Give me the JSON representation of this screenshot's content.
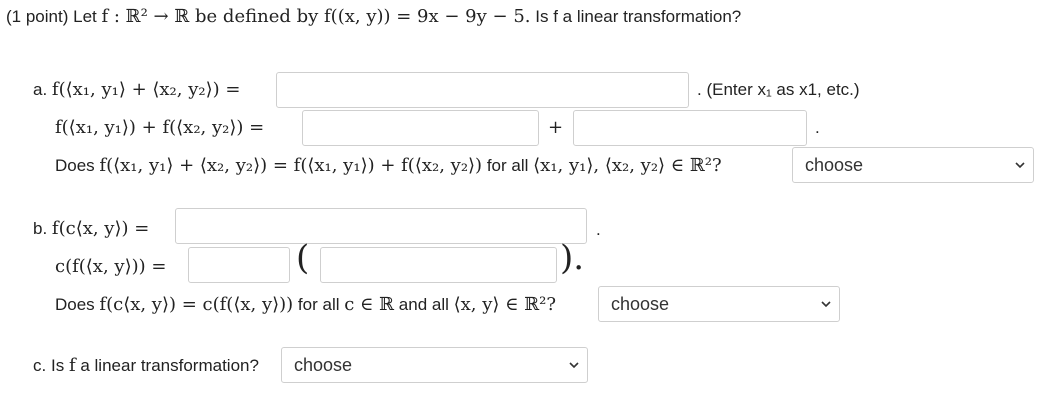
{
  "header": {
    "points": "(1 point)",
    "text_pre": "Let",
    "definition": "f : ℝ² → ℝ be defined by f((x, y)) = 9x − 9y − 5.",
    "question": "Is f a linear transformation?"
  },
  "part_a": {
    "label": "a.",
    "line1_expr": "f(⟨x₁, y₁⟩ + ⟨x₂, y₂⟩) =",
    "line1_hint": ". (Enter x₁ as x1, etc.)",
    "line2_expr": "f(⟨x₁, y₁⟩) + f(⟨x₂, y₂⟩) =",
    "plus": "+",
    "period": ".",
    "question_pre": "Does",
    "question_expr": "f(⟨x₁, y₁⟩ + ⟨x₂, y₂⟩) = f(⟨x₁, y₁⟩) + f(⟨x₂, y₂⟩)",
    "question_mid": "for all",
    "question_expr2": "⟨x₁, y₁⟩, ⟨x₂, y₂⟩ ∈ ℝ²?",
    "select_value": "choose"
  },
  "part_b": {
    "label": "b.",
    "line1_expr": "f(c⟨x, y⟩) =",
    "period": ".",
    "line2_expr": "c(f(⟨x, y⟩)) =",
    "close_paren": ").",
    "question_pre": "Does",
    "question_expr": "f(c⟨x, y⟩) = c(f(⟨x, y⟩))",
    "question_mid": "for all",
    "question_expr2": "c ∈ ℝ",
    "question_mid2": "and all",
    "question_expr3": "⟨x, y⟩ ∈ ℝ²?",
    "select_value": "choose"
  },
  "part_c": {
    "label": "c.",
    "question_pre": "Is",
    "question_expr": "f",
    "question_post": "a linear transformation?",
    "select_value": "choose"
  },
  "icons": {
    "dropdown": "chevron-down-icon"
  }
}
